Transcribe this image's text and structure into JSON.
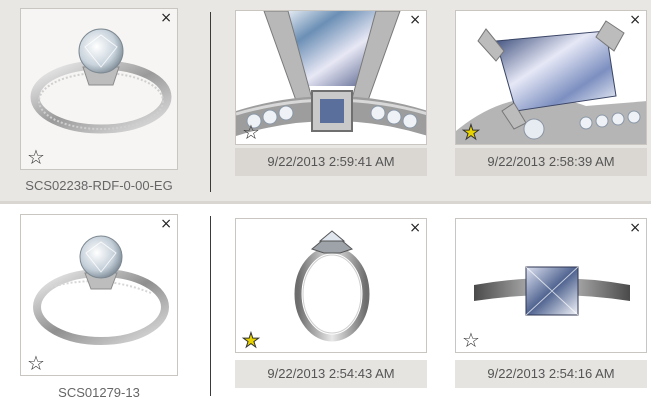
{
  "colors": {
    "row_bg_selected": "#e9e7e4",
    "row_bg": "#ffffff",
    "favorite_star": "#e8d300",
    "caption_text": "#666666"
  },
  "close_glyph": "×",
  "star_empty": "☆",
  "star_filled": "★",
  "rows": [
    {
      "product_code": "SCS02238-RDF-0-00-EG",
      "main_image": "ring-pave-band-icon",
      "thumbnails": [
        {
          "timestamp": "9/22/2013 2:59:41 AM",
          "favorite": false,
          "image": "ring-prong-closeup-icon"
        },
        {
          "timestamp": "9/22/2013 2:58:39 AM",
          "favorite": true,
          "image": "ring-princess-stone-icon"
        }
      ]
    },
    {
      "product_code": "SCS01279-13",
      "main_image": "ring-solitaire-pave-icon",
      "thumbnails": [
        {
          "timestamp": "9/22/2013 2:54:43 AM",
          "favorite": true,
          "image": "ring-side-view-icon"
        },
        {
          "timestamp": "9/22/2013 2:54:16 AM",
          "favorite": false,
          "image": "ring-top-view-icon"
        }
      ]
    }
  ]
}
